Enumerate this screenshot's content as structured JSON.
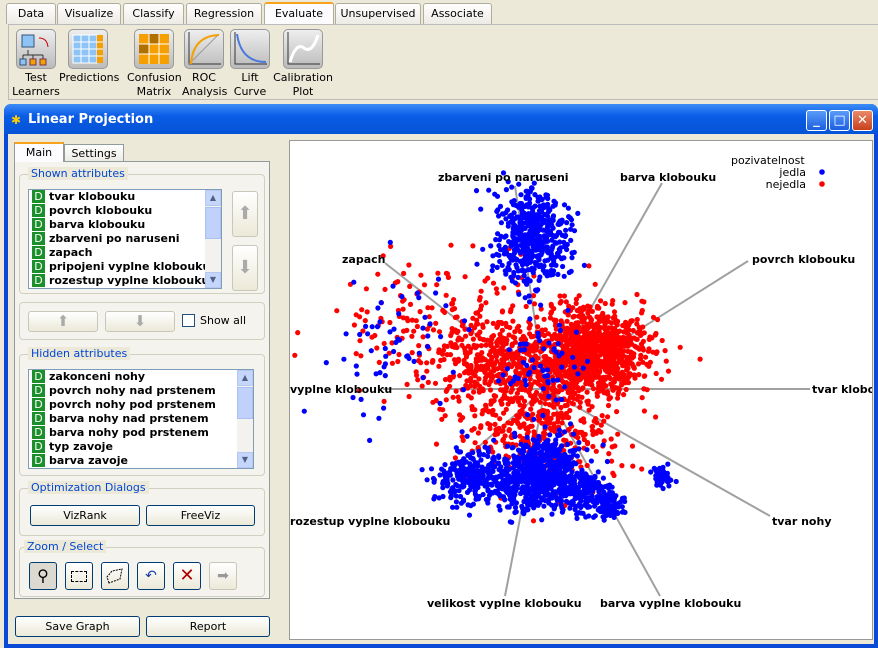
{
  "toolbox": {
    "tabs": [
      {
        "label": "Data"
      },
      {
        "label": "Visualize"
      },
      {
        "label": "Classify"
      },
      {
        "label": "Regression"
      },
      {
        "label": "Evaluate",
        "active": true
      },
      {
        "label": "Unsupervised"
      },
      {
        "label": "Associate"
      }
    ],
    "tools": [
      {
        "label1": "Test",
        "label2": "Learners",
        "icon": "test-learners-icon"
      },
      {
        "label1": "Predictions",
        "label2": "",
        "icon": "predictions-icon"
      },
      {
        "label1": "Confusion",
        "label2": "Matrix",
        "icon": "confusion-matrix-icon"
      },
      {
        "label1": "ROC",
        "label2": "Analysis",
        "icon": "roc-curve-icon"
      },
      {
        "label1": "Lift",
        "label2": "Curve",
        "icon": "lift-curve-icon"
      },
      {
        "label1": "Calibration",
        "label2": "Plot",
        "icon": "calibration-plot-icon"
      }
    ]
  },
  "window": {
    "title": "Linear Projection",
    "minimize": "_",
    "maximize": "□",
    "close": "✕"
  },
  "panel": {
    "tabs": [
      {
        "label": "Main"
      },
      {
        "label": "Settings"
      }
    ],
    "shown_label": "Shown attributes",
    "shown": [
      "tvar klobouku",
      "povrch klobouku",
      "barva klobouku",
      "zbarveni po naruseni",
      "zapach",
      "pripojeni vyplne klobouku",
      "rozestup vyplne klobouku"
    ],
    "show_all": "Show all",
    "show_all_checked": false,
    "hidden_label": "Hidden attributes",
    "hidden": [
      "zakonceni nohy",
      "povrch nohy nad prstenem",
      "povrch nohy pod prstenem",
      "barva nohy nad prstenem",
      "barva nohy pod prstenem",
      "typ zavoje",
      "barva zavoje"
    ],
    "type_badge": "D",
    "opt_label": "Optimization Dialogs",
    "vizrank": "VizRank",
    "freeviz": "FreeViz",
    "zoom_label": "Zoom / Select",
    "save_graph": "Save Graph",
    "report": "Report"
  },
  "chart_data": {
    "type": "scatter",
    "legend_title": "pozivatelnost",
    "legend_placement": "top-right",
    "classes": [
      {
        "name": "jedla",
        "color": "#0000ff"
      },
      {
        "name": "nejedla",
        "color": "#ff0000"
      }
    ],
    "anchors": [
      "tvar klobouku",
      "povrch klobouku",
      "barva klobouku",
      "zbarveni po naruseni",
      "zapach",
      "pripojeni vyplne klobouku",
      "rozestup vyplne klobouku",
      "velikost vyplne klobouku",
      "barva vyplne klobouku",
      "tvar nohy"
    ],
    "anchor_labels_shown": [
      "tvar klobo",
      "povrch klobouku",
      "barva klobouku",
      "zbarveni po naruseni",
      "zapach",
      "vyplne klobouku",
      "rozestup vyplne klobouku",
      "velikost vyplne klobouku",
      "barva vyplne klobouku",
      "tvar nohy"
    ],
    "grid": false
  }
}
